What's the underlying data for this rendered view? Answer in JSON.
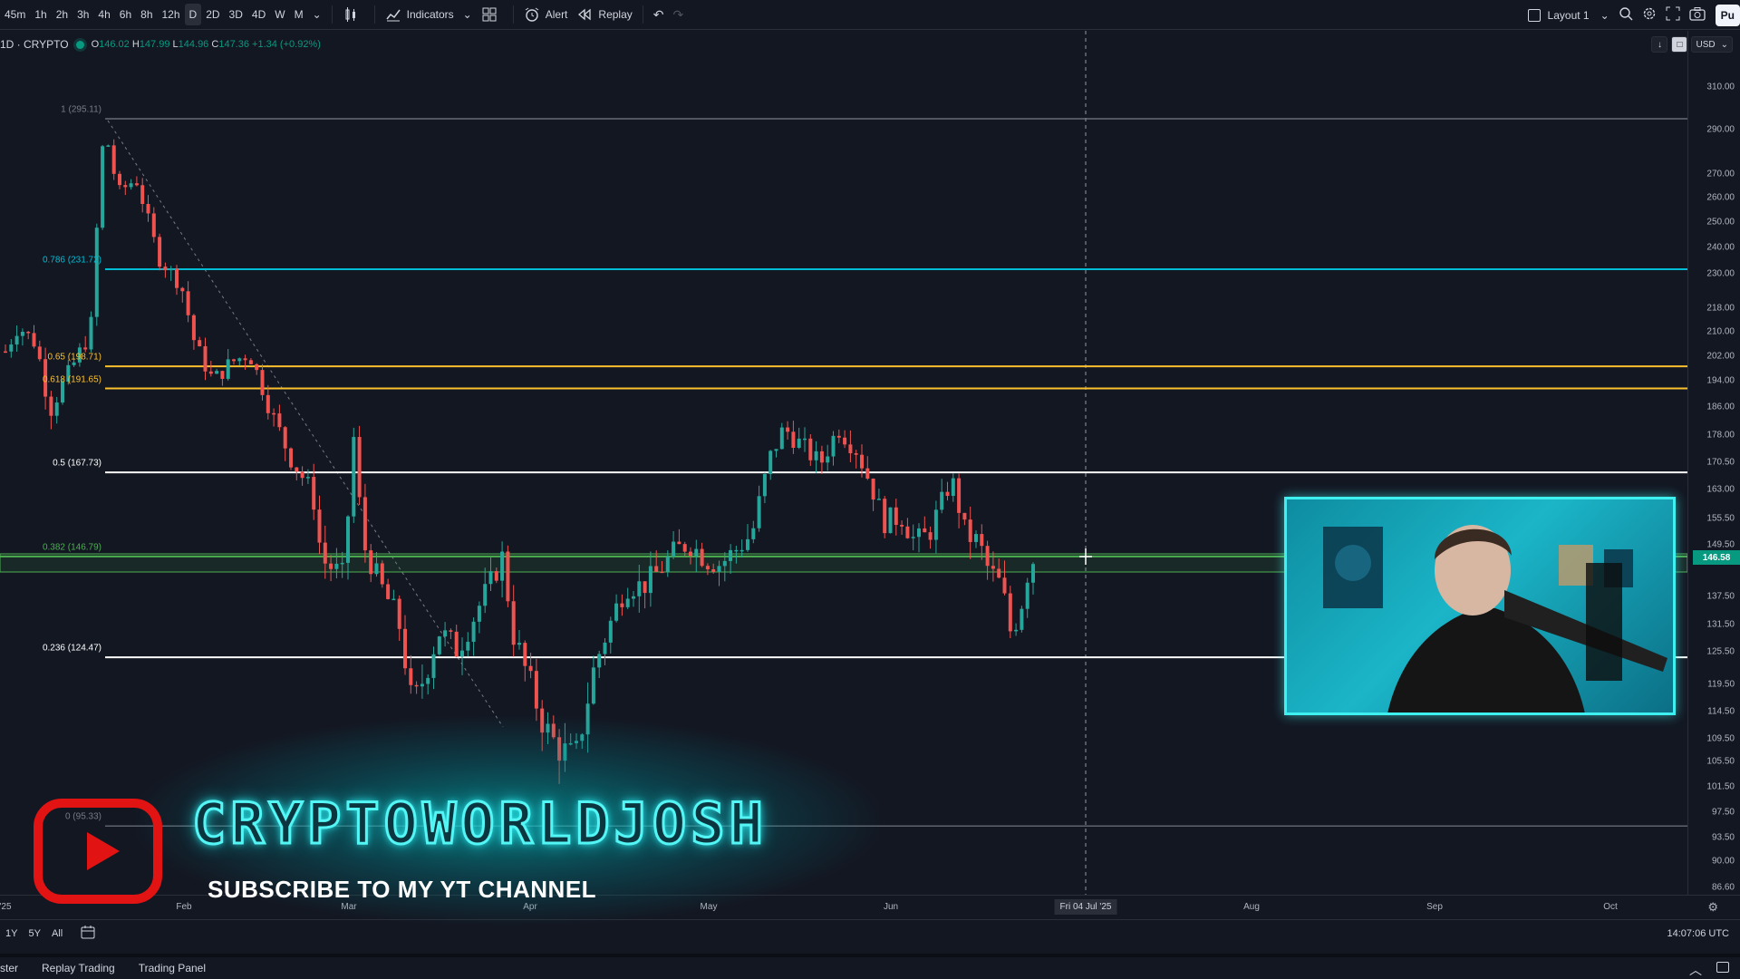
{
  "toolbar": {
    "intervals": [
      "45m",
      "1h",
      "2h",
      "3h",
      "4h",
      "6h",
      "8h",
      "12h",
      "D",
      "2D",
      "3D",
      "4D",
      "W",
      "M"
    ],
    "active_interval": "D",
    "indicators_label": "Indicators",
    "alert_label": "Alert",
    "replay_label": "Replay",
    "layout_label": "Layout 1",
    "publish_label": "Pu"
  },
  "symbol": {
    "name": "1D · CRYPTO",
    "o": "146.02",
    "h": "147.99",
    "l": "144.96",
    "c": "147.36",
    "change": "+1.34 (+0.92%)"
  },
  "price_axis": {
    "currency": "USD",
    "ticks": [
      "310.00",
      "290.00",
      "270.00",
      "260.00",
      "250.00",
      "240.00",
      "230.00",
      "218.00",
      "210.00",
      "202.00",
      "194.00",
      "186.00",
      "178.00",
      "170.50",
      "163.00",
      "155.50",
      "149.50",
      "137.50",
      "131.50",
      "125.50",
      "119.50",
      "114.50",
      "109.50",
      "105.50",
      "101.50",
      "97.50",
      "93.50",
      "90.00",
      "86.60"
    ],
    "last_price": "146.58"
  },
  "fib_levels": [
    {
      "label": "1 (295.11)",
      "value": 295.11,
      "color": "#787b86"
    },
    {
      "label": "0.786 (231.72)",
      "value": 231.72,
      "color": "#00bcd4"
    },
    {
      "label": "0.65 (198.71)",
      "value": 198.71,
      "color": "#fbc02d"
    },
    {
      "label": "0.618 (191.65)",
      "value": 191.65,
      "color": "#fbc02d"
    },
    {
      "label": "0.5 (167.73)",
      "value": 167.73,
      "color": "#ffffff"
    },
    {
      "label": "0.382 (146.79)",
      "value": 146.79,
      "color": "#4caf50"
    },
    {
      "label": "0.236 (124.47)",
      "value": 124.47,
      "color": "#ffffff"
    },
    {
      "label": "0 (95.33)",
      "value": 95.33,
      "color": "#787b86"
    }
  ],
  "time_axis": {
    "ticks": [
      "'25",
      "Feb",
      "Mar",
      "Apr",
      "May",
      "Jun",
      "Aug",
      "Sep",
      "Oct"
    ],
    "cursor_label": "Fri 04 Jul '25"
  },
  "range_bar": {
    "buttons": [
      "1Y",
      "5Y",
      "All"
    ],
    "clock": "14:07:06 UTC"
  },
  "bottom_tabs": [
    "ster",
    "Replay Trading",
    "Trading Panel"
  ],
  "branding": {
    "channel_name": "CRYPTOWORLDJOSH",
    "subscribe_text": "SUBSCRIBE TO MY YT CHANNEL"
  },
  "colors": {
    "up": "#26a69a",
    "down": "#ef5350",
    "background": "#131722",
    "accent": "#2ef2f2"
  }
}
